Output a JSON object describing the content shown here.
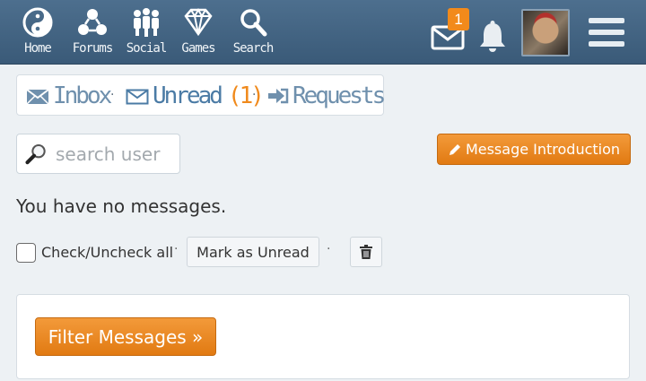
{
  "nav": {
    "home": "Home",
    "forums": "Forums",
    "social": "Social",
    "games": "Games",
    "search": "Search"
  },
  "notifications": {
    "message_count": "1"
  },
  "tabs": {
    "inbox": "Inbox",
    "unread": "Unread",
    "unread_count": "(1)",
    "requests": "Requests",
    "separator": "·"
  },
  "search": {
    "placeholder": "search user",
    "value": ""
  },
  "intro_button": "Message Introduction",
  "empty_text": "You have no messages.",
  "actions": {
    "check_all": "Check/Uncheck all",
    "mark_unread": "Mark as Unread",
    "separator": "·"
  },
  "filter_button": "Filter Messages »",
  "colors": {
    "header": "#4d6f8e",
    "accent_orange": "#f08a1c",
    "link_blue": "#4b7ba5"
  },
  "icons": {
    "home": "yin-yang-icon",
    "forums": "forums-icon",
    "social": "people-icon",
    "games": "diamond-icon",
    "search": "search-icon",
    "messages": "envelope-icon",
    "notifications": "bell-icon",
    "menu": "hamburger-menu-icon",
    "requests": "sign-in-arrow-icon",
    "search_user": "magnifier-icon",
    "intro": "pencil-icon",
    "delete": "trash-icon"
  }
}
